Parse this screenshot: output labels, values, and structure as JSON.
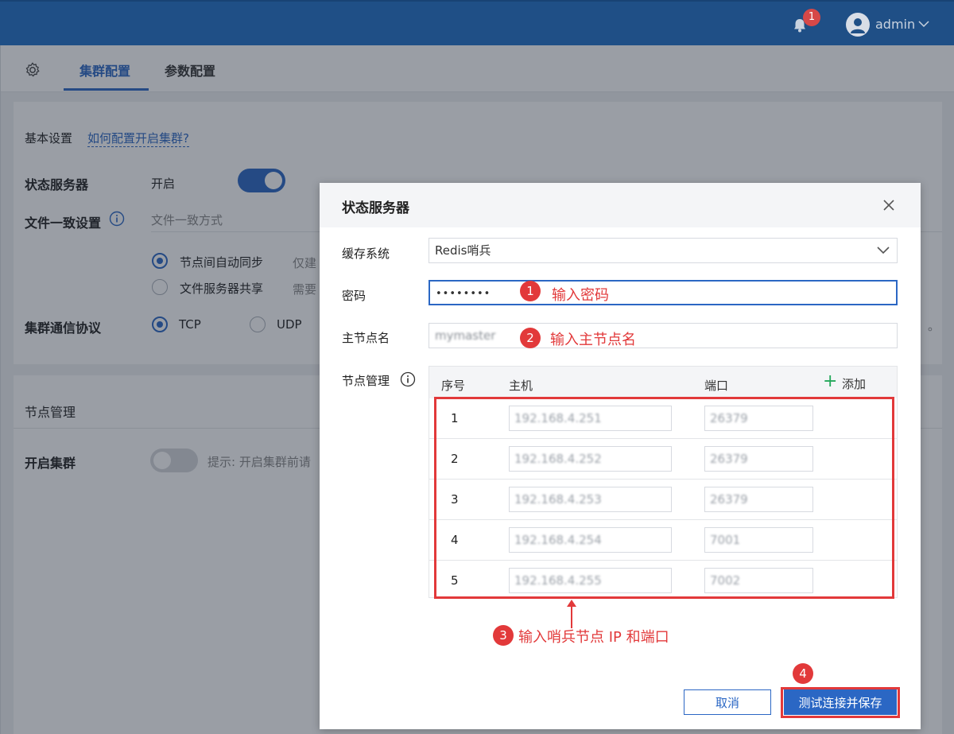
{
  "header": {
    "notification_count": "1",
    "user_name": "admin"
  },
  "tabs": [
    {
      "label": "集群配置",
      "active": true
    },
    {
      "label": "参数配置",
      "active": false
    }
  ],
  "background": {
    "basic_settings_label": "基本设置",
    "help_link": "如何配置开启集群?",
    "state_server_label": "状态服务器",
    "state_server_value": "开启",
    "file_consistency_label": "文件一致设置",
    "file_consistency_mode": "文件一致方式",
    "option_node_sync": "节点间自动同步",
    "option_node_sync_hint": "仅建",
    "option_file_share": "文件服务器共享",
    "option_file_share_hint": "需要",
    "protocol_label": "集群通信协议",
    "protocol_tcp": "TCP",
    "protocol_udp": "UDP",
    "protocol_trailing": "。",
    "node_mgmt_title": "节点管理",
    "enable_cluster_label": "开启集群",
    "enable_cluster_hint": "提示: 开启集群前请"
  },
  "modal": {
    "title": "状态服务器",
    "cache_label": "缓存系统",
    "cache_value": "Redis哨兵",
    "password_label": "密码",
    "password_value": "••••••••",
    "master_label": "主节点名",
    "master_value": "mymaster",
    "node_mgmt_label": "节点管理",
    "table": {
      "col_no": "序号",
      "col_host": "主机",
      "col_port": "端口",
      "add_label": "添加",
      "rows": [
        {
          "no": "1",
          "host": "192.168.4.251",
          "port": "26379"
        },
        {
          "no": "2",
          "host": "192.168.4.252",
          "port": "26379"
        },
        {
          "no": "3",
          "host": "192.168.4.253",
          "port": "26379"
        },
        {
          "no": "4",
          "host": "192.168.4.254",
          "port": "7001"
        },
        {
          "no": "5",
          "host": "192.168.4.255",
          "port": "7002"
        }
      ]
    },
    "cancel_label": "取消",
    "save_label": "测试连接并保存"
  },
  "annotations": {
    "step1_num": "1",
    "step1_text": "输入密码",
    "step2_num": "2",
    "step2_text": "输入主节点名",
    "step3_num": "3",
    "step3_text": "输入哨兵节点 IP 和端口",
    "step4_num": "4"
  },
  "colors": {
    "header_bg": "#1f4f86",
    "primary": "#2b67c4",
    "annotation_red": "#e2393a",
    "add_green": "#23a85a"
  }
}
